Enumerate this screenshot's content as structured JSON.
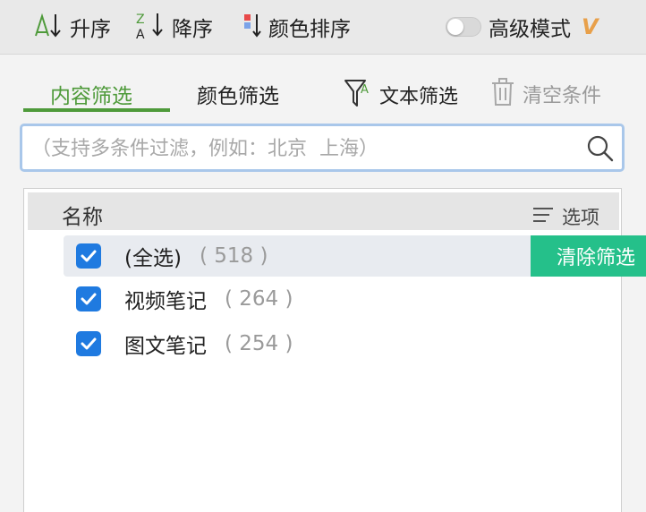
{
  "toolbar": {
    "sort_asc_label": "升序",
    "sort_desc_label": "降序",
    "color_sort_label": "颜色排序",
    "advanced_mode_label": "高级模式",
    "advanced_mode_on": false,
    "sort_desc_icon_letters": [
      "Z",
      "A"
    ]
  },
  "tabs": {
    "content_filter": "内容筛选",
    "color_filter": "颜色筛选",
    "text_filter": "文本筛选",
    "clear_conditions": "清空条件"
  },
  "search": {
    "placeholder": "（支持多条件过滤，例如：北京  上海）",
    "value": ""
  },
  "list": {
    "header_name": "名称",
    "options_label": "选项",
    "clear_filter_label": "清除筛选",
    "items": [
      {
        "label": "(全选)",
        "count": "( 518 )",
        "checked": true
      },
      {
        "label": "视频笔记",
        "count": "( 264 )",
        "checked": true
      },
      {
        "label": "图文笔记",
        "count": "( 254 )",
        "checked": true
      }
    ]
  },
  "colors": {
    "accent_green": "#4e9a3a",
    "checkbox_blue": "#1f7ae0",
    "clear_button_green": "#25c08a",
    "vip_orange": "#e8a04a",
    "search_border": "#a9c7ea"
  },
  "icons": {
    "sort_asc": "sort-ascending-icon",
    "sort_desc": "sort-descending-icon",
    "color_sort": "color-sort-icon",
    "vip": "vip-icon",
    "text_filter": "text-filter-funnel-icon",
    "clear": "trash-icon",
    "search": "search-icon",
    "options": "options-list-icon",
    "checkbox": "checkbox-checked-icon"
  }
}
